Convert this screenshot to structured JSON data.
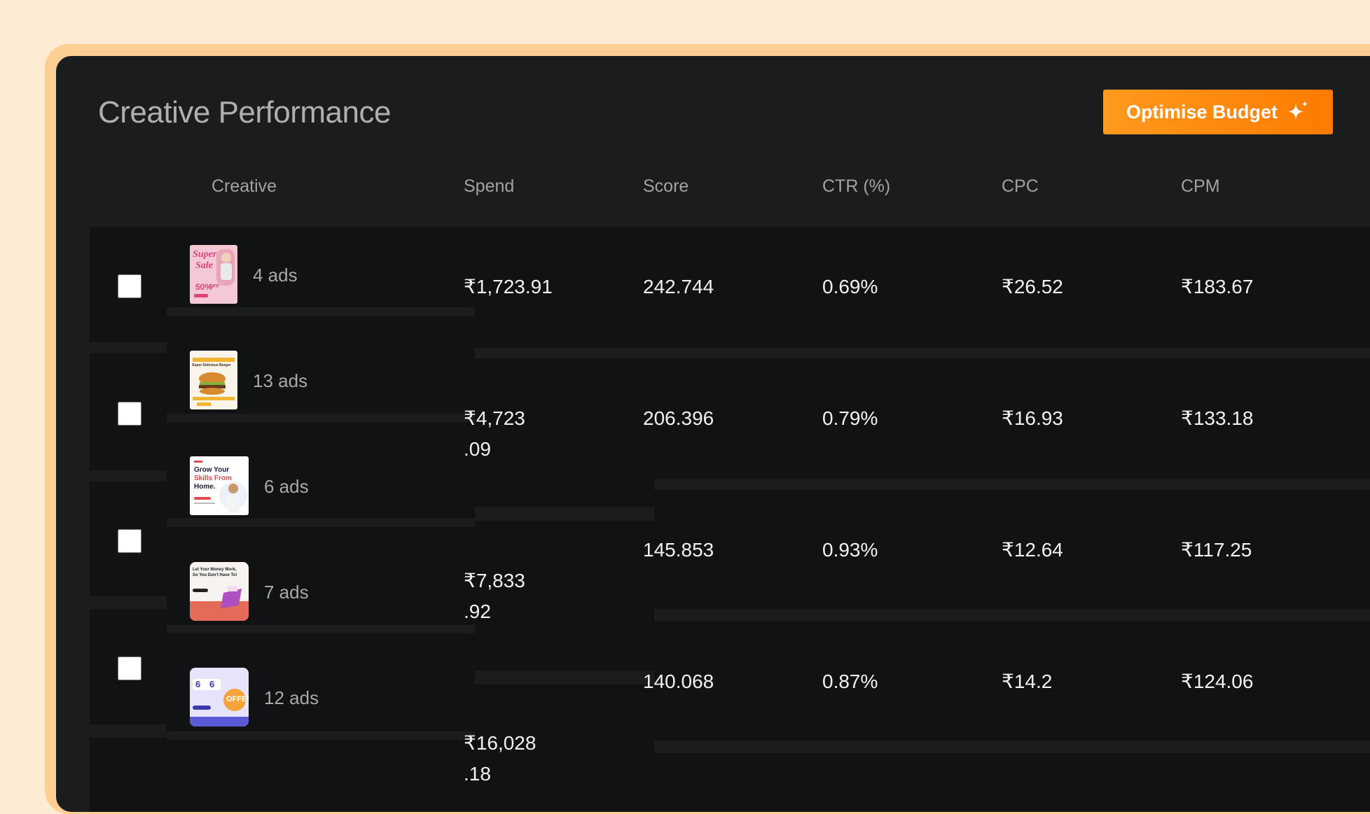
{
  "header": {
    "title": "Creative Performance",
    "optimise_button": "Optimise Budget",
    "optimise_icon": "sparkle-icon"
  },
  "columns": [
    "Creative",
    "Spend",
    "Score",
    "CTR (%)",
    "CPC",
    "CPM"
  ],
  "creatives": [
    {
      "ads": "4 ads",
      "thumb": {
        "kind": "super-sale",
        "lines": [
          "Super",
          "Sale",
          "50%",
          "OFF"
        ]
      }
    },
    {
      "ads": "13 ads",
      "thumb": {
        "kind": "burger",
        "lines": [
          "Super Delicious Burger"
        ]
      }
    },
    {
      "ads": "6 ads",
      "thumb": {
        "kind": "skills",
        "lines": [
          "Grow Your",
          "Skills From",
          "Home."
        ]
      }
    },
    {
      "ads": "7 ads",
      "thumb": {
        "kind": "money",
        "lines": [
          "Let Your Money Work,",
          "So You Don't Have To!"
        ]
      }
    },
    {
      "ads": "12 ads",
      "thumb": {
        "kind": "offer",
        "lines": [
          "6",
          "6",
          "OFFER"
        ]
      }
    }
  ],
  "spend": [
    {
      "line1": "₹1,723.91",
      "line2": ""
    },
    {
      "line1": "₹4,723",
      "line2": ".09"
    },
    {
      "line1": "₹7,833",
      "line2": ".92"
    },
    {
      "line1": "₹16,028",
      "line2": ".18"
    }
  ],
  "rows": [
    {
      "score": "242.744",
      "ctr": "0.69%",
      "cpc": "₹26.52",
      "cpm": "₹183.67"
    },
    {
      "score": "206.396",
      "ctr": "0.79%",
      "cpc": "₹16.93",
      "cpm": "₹133.18"
    },
    {
      "score": "145.853",
      "ctr": "0.93%",
      "cpc": "₹12.64",
      "cpm": "₹117.25"
    },
    {
      "score": "140.068",
      "ctr": "0.87%",
      "cpc": "₹14.2",
      "cpm": "₹124.06"
    }
  ],
  "colors": {
    "page_bg": "#FEEBD4",
    "frame": "#FDCF92",
    "panel": "#1B1C1D",
    "row_bg": "#111213",
    "accent_start": "#FF9A1F",
    "accent_end": "#FF7A00"
  }
}
